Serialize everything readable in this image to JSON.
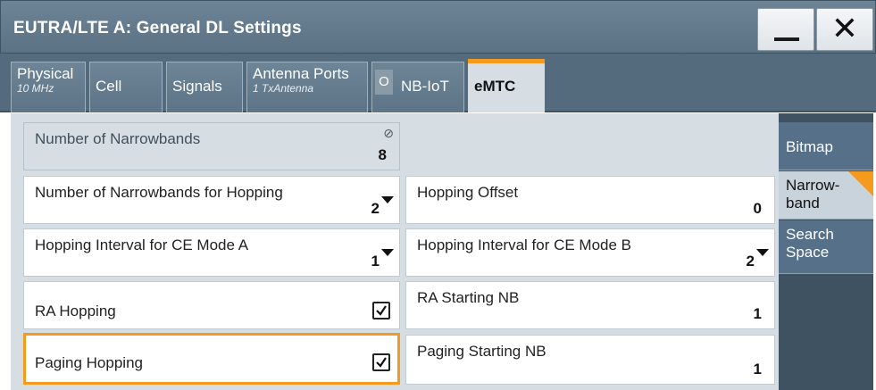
{
  "window": {
    "title": "EUTRA/LTE A: General DL Settings",
    "min_icon": "minimize-icon",
    "close_label": "✕"
  },
  "tabs": [
    {
      "label": "Physical",
      "sub": "10 MHz"
    },
    {
      "label": "Cell",
      "sub": ""
    },
    {
      "label": "Signals",
      "sub": ""
    },
    {
      "label": "Antenna Ports",
      "sub": "1 TxAntenna"
    },
    {
      "label": "NB-IoT",
      "sub": "",
      "indicator": "O"
    },
    {
      "label": "eMTC",
      "sub": "",
      "active": true
    }
  ],
  "side_tabs": [
    {
      "label": "Bitmap"
    },
    {
      "label": "Narrow-band",
      "line1": "Narrow-",
      "line2": "band",
      "active": true
    },
    {
      "label": "Search Space",
      "line1": "Search",
      "line2": "Space"
    }
  ],
  "fields": {
    "num_narrowbands": {
      "label": "Number of Narrowbands",
      "value": "8",
      "icon": "lock-icon"
    },
    "num_narrowbands_hopping": {
      "label": "Number of Narrowbands for Hopping",
      "value": "2"
    },
    "hopping_offset": {
      "label": "Hopping Offset",
      "value": "0"
    },
    "hopping_interval_a": {
      "label": "Hopping Interval for CE Mode A",
      "value": "1"
    },
    "hopping_interval_b": {
      "label": "Hopping Interval for CE Mode B",
      "value": "2"
    },
    "ra_hopping": {
      "label": "RA Hopping",
      "checked": true
    },
    "ra_starting_nb": {
      "label": "RA Starting NB",
      "value": "1"
    },
    "paging_hopping": {
      "label": "Paging Hopping",
      "checked": true
    },
    "paging_starting_nb": {
      "label": "Paging Starting NB",
      "value": "1"
    }
  },
  "colors": {
    "accent": "#f49a1c",
    "titlebar": "#5a7284",
    "panel": "#d6dde3",
    "sidebar": "#3e5262"
  }
}
